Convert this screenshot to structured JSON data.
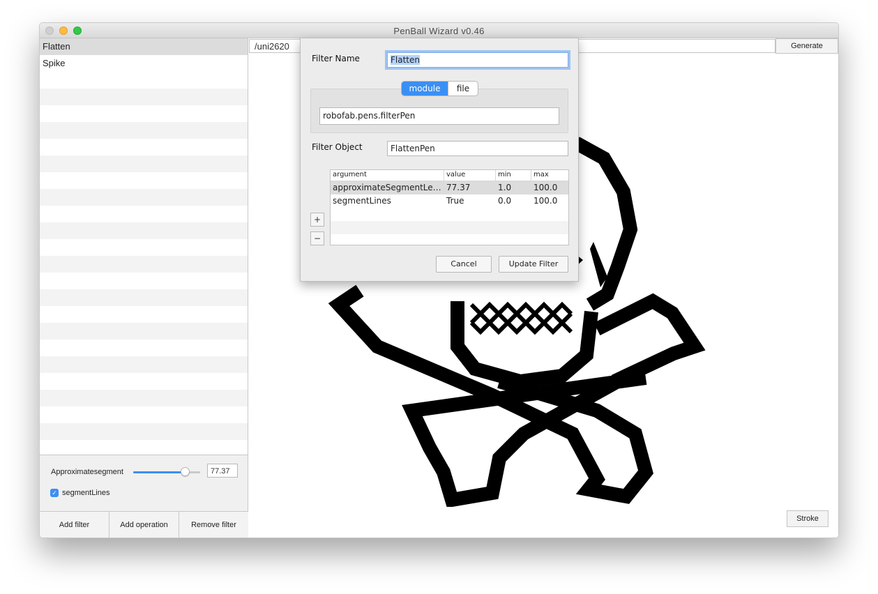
{
  "app": {
    "title": "PenBall Wizard v0.46"
  },
  "filters": {
    "items": [
      {
        "label": "Flatten",
        "selected": true
      },
      {
        "label": "Spike",
        "selected": false
      }
    ]
  },
  "params": {
    "segment_label": "Approximatesegment length",
    "segment_value": "77.37",
    "segment_fraction": 0.7737,
    "lines_label": "segmentLines",
    "lines_checked": true
  },
  "left_buttons": {
    "add_filter": "Add filter",
    "add_operation": "Add operation",
    "remove_filter": "Remove filter"
  },
  "main": {
    "glyph_name": "/uni2620",
    "generate_label": "Generate",
    "stroke_label": "Stroke"
  },
  "sheet": {
    "filter_name_label": "Filter Name",
    "filter_name_value": "Flatten",
    "segment_options": [
      "module",
      "file"
    ],
    "segment_selected": "module",
    "module_path": "robofab.pens.filterPen",
    "filter_object_label": "Filter Object",
    "filter_object_value": "FlattenPen",
    "table": {
      "columns": [
        "argument",
        "value",
        "min",
        "max"
      ],
      "rows": [
        {
          "argument": "approximateSegmentLe…",
          "value": "77.37",
          "min": "1.0",
          "max": "100.0"
        },
        {
          "argument": "segmentLines",
          "value": "True",
          "min": "0.0",
          "max": "100.0"
        }
      ]
    },
    "add_label": "+",
    "remove_label": "−",
    "cancel_label": "Cancel",
    "update_label": "Update Filter"
  },
  "colors": {
    "accent": "#3b8ff3",
    "selection": "#dcdcdc"
  }
}
